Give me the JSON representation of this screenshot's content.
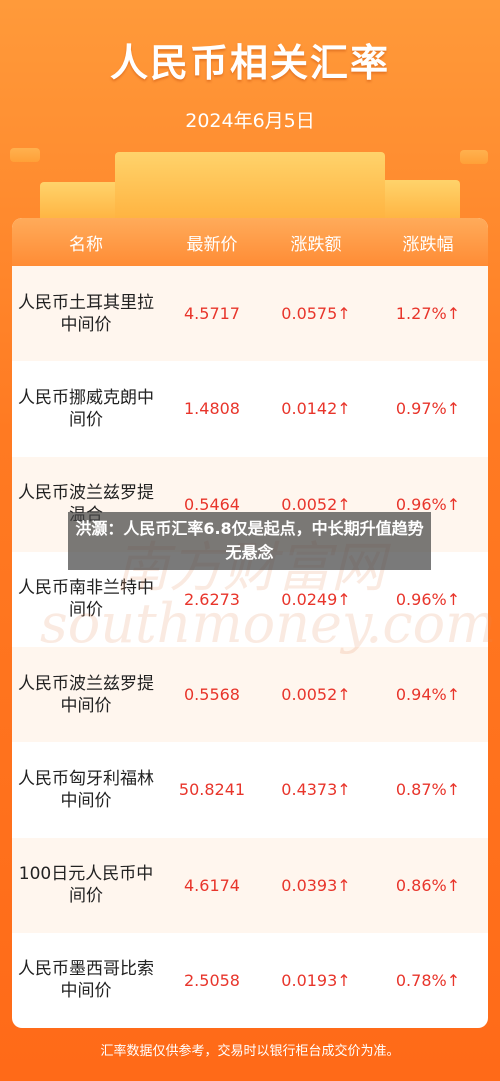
{
  "header": {
    "title": "人民币相关汇率",
    "date": "2024年6月5日"
  },
  "table": {
    "columns": [
      "名称",
      "最新价",
      "涨跌额",
      "涨跌幅"
    ],
    "rows": [
      {
        "name": "人民币土耳其里拉中间价",
        "price": "4.5717",
        "change": "0.0575↑",
        "pct": "1.27%↑"
      },
      {
        "name": "人民币挪威克朗中间价",
        "price": "1.4808",
        "change": "0.0142↑",
        "pct": "0.97%↑"
      },
      {
        "name": "人民币波兰兹罗提温合",
        "price": "0.5464",
        "change": "0.0052↑",
        "pct": "0.96%↑"
      },
      {
        "name": "人民币南非兰特中间价",
        "price": "2.6273",
        "change": "0.0249↑",
        "pct": "0.96%↑"
      },
      {
        "name": "人民币波兰兹罗提中间价",
        "price": "0.5568",
        "change": "0.0052↑",
        "pct": "0.94%↑"
      },
      {
        "name": "人民币匈牙利福林中间价",
        "price": "50.8241",
        "change": "0.4373↑",
        "pct": "0.87%↑"
      },
      {
        "name": "100日元人民币中间价",
        "price": "4.6174",
        "change": "0.0393↑",
        "pct": "0.86%↑"
      },
      {
        "name": "人民币墨西哥比索中间价",
        "price": "2.5058",
        "change": "0.0193↑",
        "pct": "0.78%↑"
      }
    ]
  },
  "overlay": {
    "headline": "洪灏：人民币汇率6.8仅是起点，中长期升值趋势无悬念",
    "watermark": "南方财富网 southmoney.com"
  },
  "footer": {
    "note": "汇率数据仅供参考，交易时以银行柜台成交价为准。"
  },
  "colors": {
    "background": "#ff7a22",
    "accent_red": "#e8352b",
    "row_stripe": "#fff6ee"
  }
}
